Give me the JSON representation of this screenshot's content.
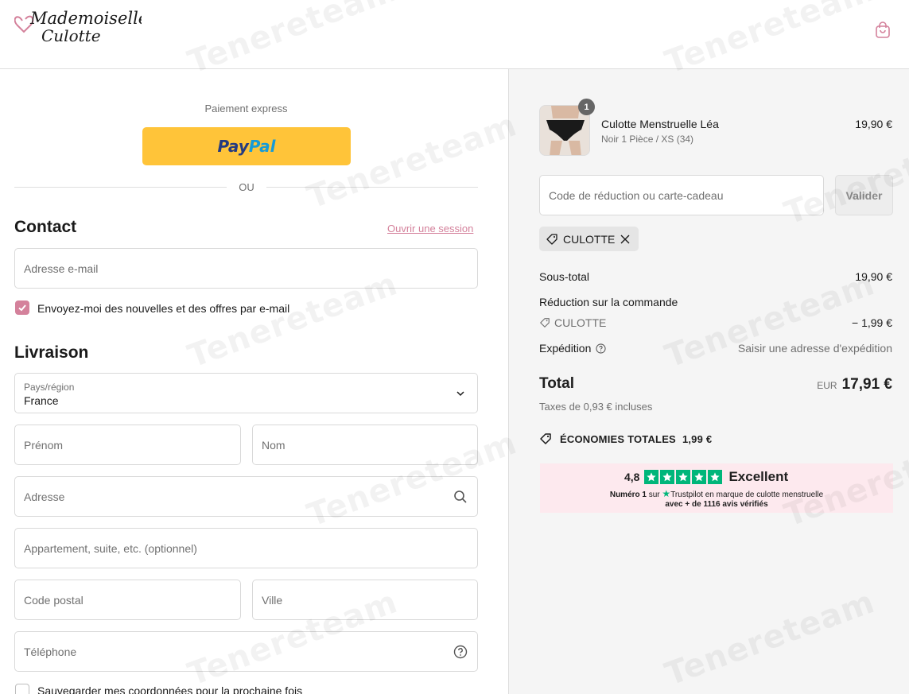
{
  "header": {
    "logo_line1": "Mademoiselle",
    "logo_line2": "Culotte",
    "cart_icon": "shopping-bag-icon"
  },
  "express": {
    "label": "Paiement express",
    "paypal_pay": "Pay",
    "paypal_pal": "Pal",
    "or": "OU"
  },
  "contact": {
    "title": "Contact",
    "login_link": "Ouvrir une session",
    "email_placeholder": "Adresse e-mail",
    "newsletter_label": "Envoyez-moi des nouvelles et des offres par e-mail",
    "newsletter_checked": true
  },
  "delivery": {
    "title": "Livraison",
    "country_label": "Pays/région",
    "country_value": "France",
    "first_name_placeholder": "Prénom",
    "last_name_placeholder": "Nom",
    "address_placeholder": "Adresse",
    "apartment_placeholder": "Appartement, suite, etc. (optionnel)",
    "postal_placeholder": "Code postal",
    "city_placeholder": "Ville",
    "phone_placeholder": "Téléphone",
    "save_label": "Sauvegarder mes coordonnées pour la prochaine fois",
    "save_checked": false
  },
  "summary": {
    "product": {
      "qty": "1",
      "name": "Culotte Menstruelle Léa",
      "variant": "Noir 1 Pièce / XS (34)",
      "price": "19,90 €"
    },
    "discount_placeholder": "Code de réduction ou carte-cadeau",
    "apply_label": "Valider",
    "applied_code": "CULOTTE",
    "subtotal_label": "Sous-total",
    "subtotal_value": "19,90 €",
    "order_discount_label": "Réduction sur la commande",
    "discount_code_label": "CULOTTE",
    "discount_value": "− 1,99 €",
    "shipping_label": "Expédition",
    "shipping_value": "Saisir une adresse d'expédition",
    "total_label": "Total",
    "currency": "EUR",
    "total_value": "17,91 €",
    "tax_note": "Taxes de 0,93 € incluses",
    "savings_label": "ÉCONOMIES TOTALES",
    "savings_value": "1,99 €"
  },
  "trustpilot": {
    "score": "4,8",
    "rating_word": "Excellent",
    "line2_bold": "Numéro 1",
    "line2_mid": " sur ",
    "line2_brand": "Trustpilot",
    "line2_rest": " en marque de culotte menstruelle",
    "line3": "avec + de 1116 avis vérifiés",
    "star_color": "#00b67a"
  },
  "colors": {
    "accent": "#d4819b",
    "paypal_yellow": "#ffc439"
  }
}
